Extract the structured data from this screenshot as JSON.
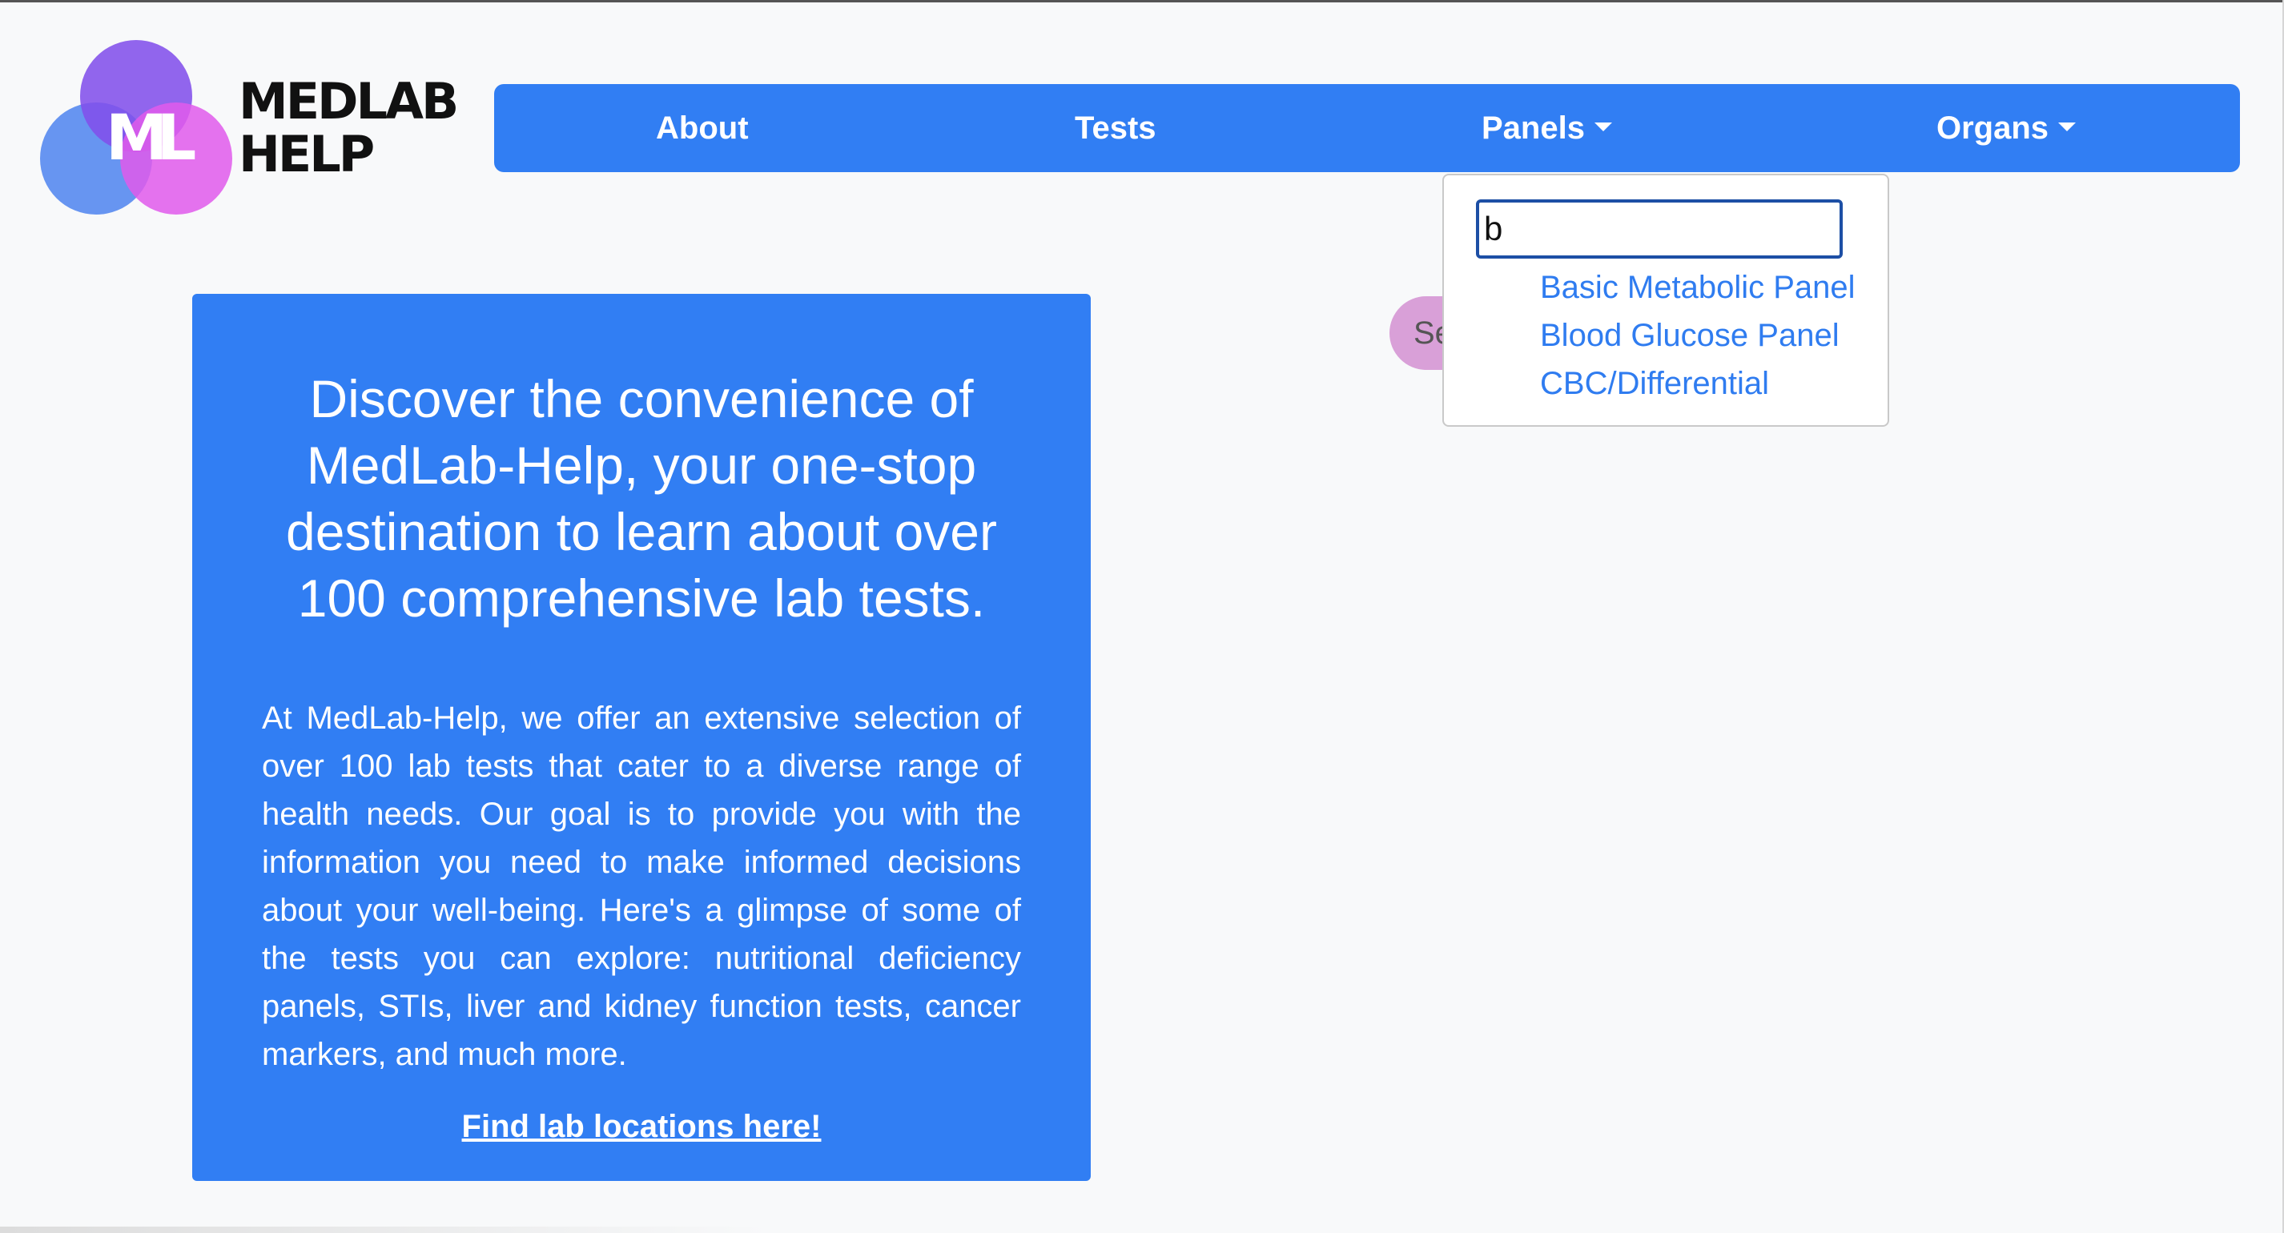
{
  "brand": {
    "mark": "ML",
    "name_line1": "MEDLAB",
    "name_line2": "HELP"
  },
  "navbar": {
    "items": [
      {
        "label": "About",
        "has_dropdown": false
      },
      {
        "label": "Tests",
        "has_dropdown": false
      },
      {
        "label": "Panels",
        "has_dropdown": true
      },
      {
        "label": "Organs",
        "has_dropdown": true
      }
    ]
  },
  "panels_dropdown": {
    "search_value": "b",
    "results": [
      "Basic Metabolic Panel",
      "Blood Glucose Panel",
      "CBC/Differential"
    ]
  },
  "hidden_button": {
    "visible_text": "Se"
  },
  "hero": {
    "title": "Discover the convenience of MedLab-Help, your one-stop destination to learn about over 100 comprehensive lab tests.",
    "body": "At MedLab-Help, we offer an extensive selection of over 100 lab tests that cater to a diverse range of health needs. Our goal is to provide you with the information you need to make informed decisions about your well-being. Here's a glimpse of some of the tests you can explore: nutritional deficiency panels, STIs, liver and kidney function tests, cancer markers, and much more.",
    "link_label": "Find lab locations here!"
  },
  "colors": {
    "primary": "#317ef3",
    "page_background": "#f8f9fa",
    "dropdown_link": "#2f7cf0",
    "logo_blue": "#5a8cf0",
    "logo_purple": "#8250eb",
    "logo_pink": "#e15aeb",
    "hidden_button": "#d9a0d8"
  },
  "icons": [
    "caret-down-icon"
  ]
}
